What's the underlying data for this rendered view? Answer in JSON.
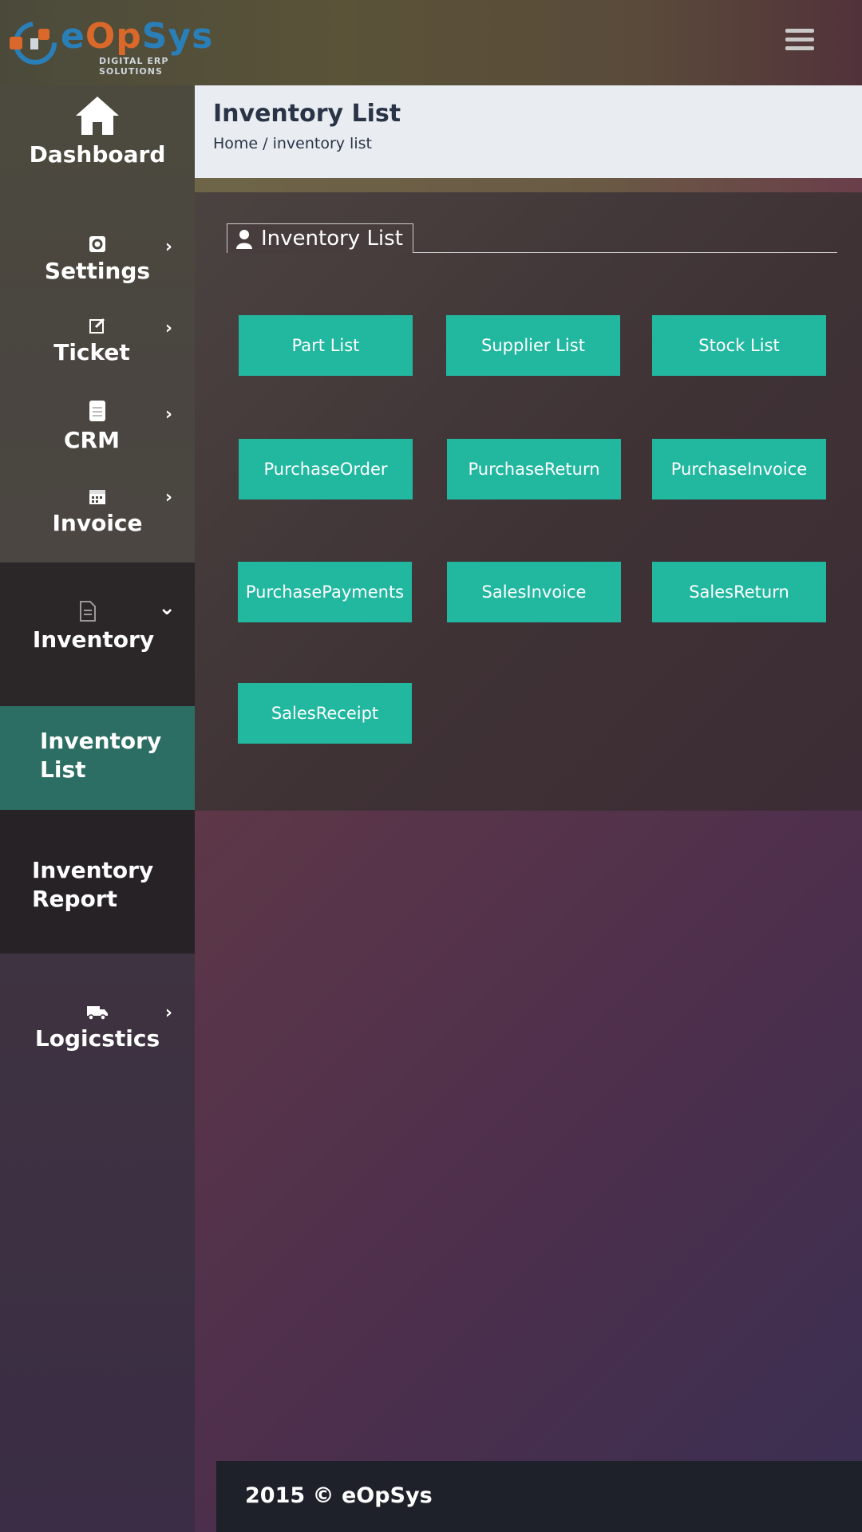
{
  "header": {
    "logo_text_a": "e",
    "logo_text_o": "Op",
    "logo_text_b": "Sys",
    "logo_tagline": "DIGITAL ERP SOLUTIONS",
    "menu_icon": "hamburger-icon"
  },
  "sidebar": {
    "dashboard": {
      "label": "Dashboard",
      "icon": "home-icon"
    },
    "settings": {
      "label": "Settings",
      "icon": "gear-icon"
    },
    "ticket": {
      "label": "Ticket",
      "icon": "edit-icon"
    },
    "crm": {
      "label": "CRM",
      "icon": "document-icon"
    },
    "invoice": {
      "label": "Invoice",
      "icon": "calendar-icon"
    },
    "inventory": {
      "label": "Inventory",
      "icon": "file-icon"
    },
    "inventory_list": {
      "label": "Inventory List"
    },
    "inventory_report": {
      "label": "Inventory Report"
    },
    "logistics": {
      "label": "Logicstics",
      "icon": "truck-icon"
    },
    "chevron_right": "›",
    "chevron_down": "⌄"
  },
  "page": {
    "title": "Inventory List",
    "breadcrumb_home": "Home",
    "breadcrumb_sep": " / ",
    "breadcrumb_current": "inventory list"
  },
  "panel": {
    "legend": "Inventory List",
    "legend_icon": "user-icon",
    "tiles": [
      "Part List",
      "Supplier List",
      "Stock List",
      "PurchaseOrder",
      "PurchaseReturn",
      "PurchaseInvoice",
      "PurchasePayments",
      "SalesInvoice",
      "SalesReturn",
      "SalesReceipt"
    ]
  },
  "footer": {
    "text": "2015 © eOpSys"
  },
  "colors": {
    "accent": "#22b8a0",
    "active_sidebar": "#2c6e63",
    "title_bar": "#e9ecf1"
  }
}
